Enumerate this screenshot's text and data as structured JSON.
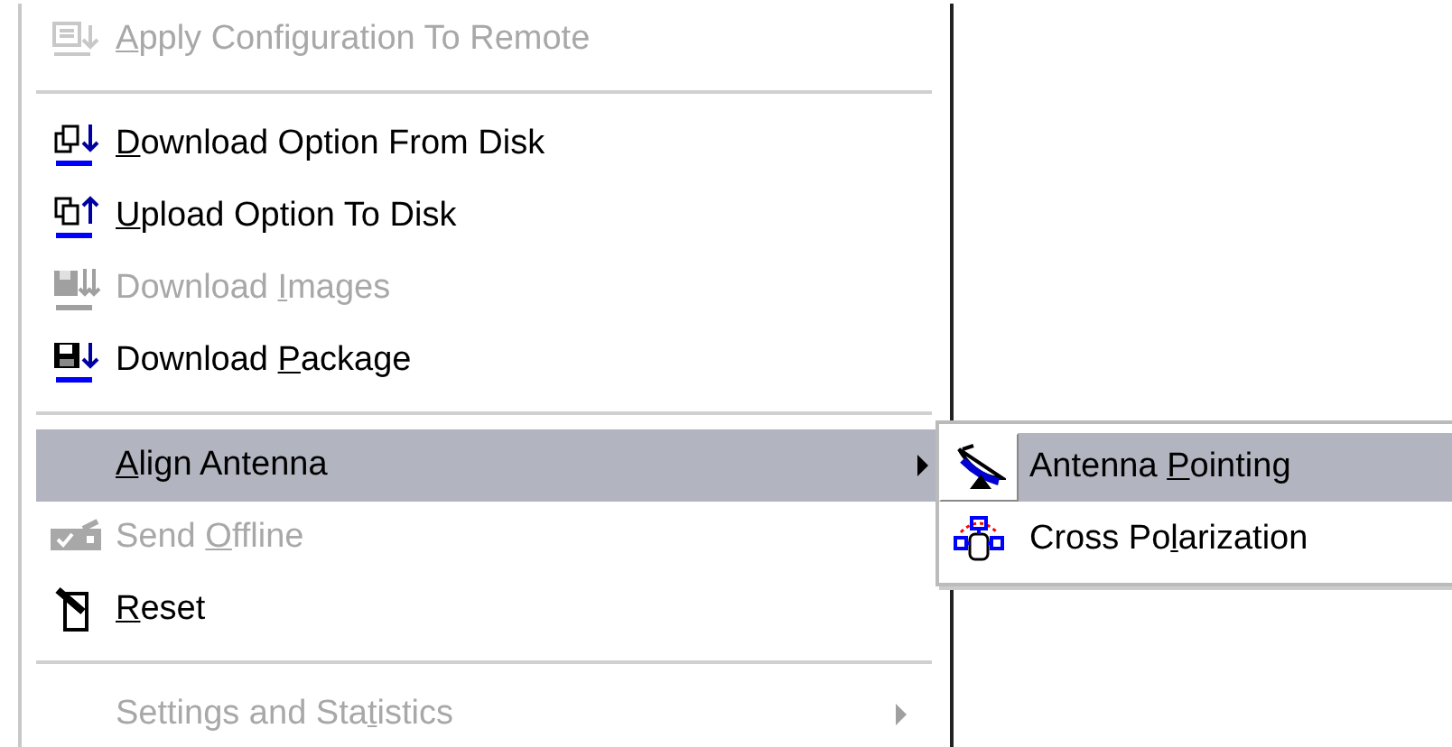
{
  "menu": {
    "items": [
      {
        "kind": "item",
        "access_key": "A",
        "text_after": "pply Configuration To Remote",
        "disabled": true,
        "selected": false,
        "submenu": false
      },
      {
        "kind": "separator"
      },
      {
        "kind": "item",
        "access_key": "D",
        "text_after": "ownload Option From Disk",
        "disabled": false,
        "selected": false,
        "submenu": false
      },
      {
        "kind": "item",
        "access_key": "U",
        "text_after": "pload Option To Disk",
        "disabled": false,
        "selected": false,
        "submenu": false
      },
      {
        "kind": "item",
        "text_before": "Download ",
        "access_key": "I",
        "text_after": "mages",
        "disabled": true,
        "selected": false,
        "submenu": false
      },
      {
        "kind": "item",
        "text_before": "Download ",
        "access_key": "P",
        "text_after": "ackage",
        "disabled": false,
        "selected": false,
        "submenu": false
      },
      {
        "kind": "separator"
      },
      {
        "kind": "item",
        "access_key": "A",
        "text_after": "lign Antenna",
        "disabled": false,
        "selected": true,
        "submenu": true
      },
      {
        "kind": "item",
        "text_before": "Send ",
        "access_key": "O",
        "text_after": "ffline",
        "disabled": true,
        "selected": false,
        "submenu": false
      },
      {
        "kind": "item",
        "access_key": "R",
        "text_after": "eset",
        "disabled": false,
        "selected": false,
        "submenu": false
      },
      {
        "kind": "separator"
      },
      {
        "kind": "item",
        "text_before": "Settings and Sta",
        "access_key": "t",
        "text_after": "istics",
        "disabled": true,
        "selected": false,
        "submenu": true
      }
    ]
  },
  "submenu": {
    "items": [
      {
        "text_before": "Antenna ",
        "access_key": "P",
        "text_after": "ointing",
        "selected": true
      },
      {
        "text_before": "Cross Po",
        "access_key": "l",
        "text_after": "arization",
        "selected": false
      }
    ]
  }
}
